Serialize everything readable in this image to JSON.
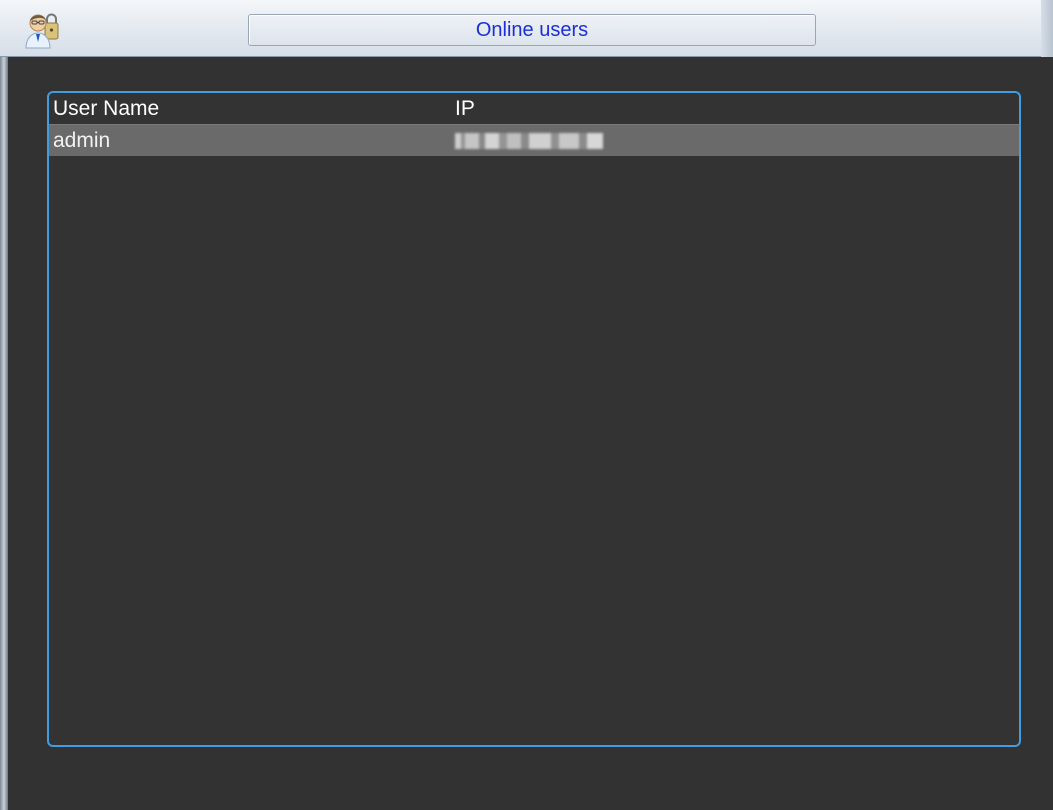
{
  "window": {
    "title": "Online users",
    "icon": "user-lock-icon"
  },
  "table": {
    "columns": [
      "User Name",
      "IP"
    ],
    "rows": [
      {
        "user_name": "admin",
        "ip": ""
      }
    ]
  },
  "colors": {
    "accent": "#3f9de0",
    "title_text": "#1a2fd8",
    "background": "#323232",
    "selected_row": "#6a6a6a"
  }
}
